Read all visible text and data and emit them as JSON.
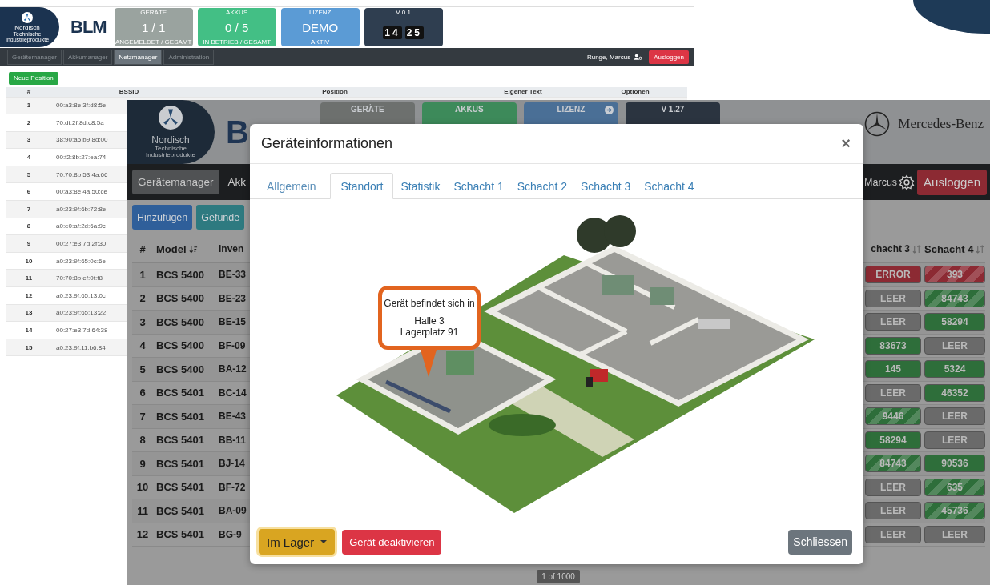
{
  "back_window": {
    "brand": {
      "name": "Nordisch",
      "tagline": "Technische Industrieprodukte",
      "logo": "BLM"
    },
    "tiles": [
      {
        "kind": "stat",
        "title": "GERÄTE",
        "value": "1 / 1",
        "caption": "ANGEMELDET / GESAMT",
        "color": "#9aa39f"
      },
      {
        "kind": "stat",
        "title": "AKKUS",
        "value": "0 / 5",
        "caption": "IN BETRIEB / GESAMT",
        "color": "#43bf85"
      },
      {
        "kind": "stat",
        "title": "LIZENZ",
        "value": "DEMO",
        "caption": "AKTIV",
        "color": "#5b9bd5"
      },
      {
        "kind": "clock",
        "title": "V 0.1",
        "digits": [
          "14",
          "25"
        ],
        "color": "#2f3e50"
      }
    ],
    "nav": [
      {
        "label": "Gerätemanager",
        "selected": false
      },
      {
        "label": "Akkumanager",
        "selected": false
      },
      {
        "label": "Netzmanager",
        "selected": true
      },
      {
        "label": "Administration",
        "selected": false
      }
    ],
    "user": "Runge, Marcus",
    "logout": "Ausloggen",
    "new_button": "Neue Position",
    "table": {
      "columns": [
        "#",
        "BSSID",
        "Position",
        "Eigener Text",
        "Optionen"
      ],
      "rows": [
        {
          "index": "1",
          "bssid": "00:a3:8e:3f:d8:5e"
        },
        {
          "index": "2",
          "bssid": "70:df:2f:8d:c8:5a"
        },
        {
          "index": "3",
          "bssid": "38:90:a5:b9:8d:00"
        },
        {
          "index": "4",
          "bssid": "00:f2:8b:27:ea:74"
        },
        {
          "index": "5",
          "bssid": "70:70:8b:53:4a:66"
        },
        {
          "index": "6",
          "bssid": "00:a3:8e:4a:50:ce"
        },
        {
          "index": "7",
          "bssid": "a0:23:9f:6b:72:8e"
        },
        {
          "index": "8",
          "bssid": "a0:e0:af:2d:6a:9c"
        },
        {
          "index": "9",
          "bssid": "00:27:e3:7d:2f:30"
        },
        {
          "index": "10",
          "bssid": "a0:23:9f:65:0c:6e"
        },
        {
          "index": "11",
          "bssid": "70:70:8b:ef:0f:f8"
        },
        {
          "index": "12",
          "bssid": "a0:23:9f:65:13:0c"
        },
        {
          "index": "13",
          "bssid": "a0:23:9f:65:13:22"
        },
        {
          "index": "14",
          "bssid": "00:27:e3:7d:64:38"
        },
        {
          "index": "15",
          "bssid": "a0:23:9f:11:b6:84"
        }
      ]
    }
  },
  "front_window": {
    "brand": {
      "name": "Nordisch",
      "tagline": "Technische Industrieprodukte",
      "logo": "B"
    },
    "tiles": [
      {
        "title": "GERÄTE",
        "color": "#6d706e",
        "link": false
      },
      {
        "title": "AKKUS",
        "color": "#3d8a5a",
        "link": false
      },
      {
        "title": "LIZENZ",
        "color": "#4a6f96",
        "link": true
      },
      {
        "title": "V 1.27",
        "color": "#2b3440",
        "link": false
      }
    ],
    "partner": "Mercedes-Benz",
    "nav": [
      {
        "label": "Gerätemanager",
        "selected": true
      },
      {
        "label": "Akk",
        "selected": false
      }
    ],
    "user": "Marcus",
    "logout": "Ausloggen",
    "buttons": [
      {
        "label": "Hinzufügen",
        "kind": "primary"
      },
      {
        "label": "Gefunde",
        "kind": "info"
      }
    ],
    "table": {
      "columns": [
        {
          "label": "#"
        },
        {
          "label": "Model",
          "sorted": true
        },
        {
          "label": "Inven"
        },
        {
          "label": "chacht 3",
          "sorted": false
        },
        {
          "label": "Schacht 4",
          "sorted": false
        }
      ],
      "rows": [
        {
          "index": "1",
          "model": "BCS 5400",
          "inventory": "BE-33",
          "slots": [
            {
              "label": "ERROR",
              "kind": "error",
              "striped": false
            },
            {
              "label": "393",
              "kind": "error",
              "striped": true
            }
          ]
        },
        {
          "index": "2",
          "model": "BCS 5400",
          "inventory": "BE-23",
          "slots": [
            {
              "label": "LEER",
              "kind": "empty",
              "striped": false
            },
            {
              "label": "84743",
              "kind": "ok",
              "striped": true
            }
          ]
        },
        {
          "index": "3",
          "model": "BCS 5400",
          "inventory": "BE-15",
          "slots": [
            {
              "label": "LEER",
              "kind": "empty",
              "striped": false
            },
            {
              "label": "58294",
              "kind": "ok",
              "striped": false
            }
          ]
        },
        {
          "index": "4",
          "model": "BCS 5400",
          "inventory": "BF-09",
          "slots": [
            {
              "label": "83673",
              "kind": "ok",
              "striped": false
            },
            {
              "label": "LEER",
              "kind": "empty",
              "striped": false
            }
          ]
        },
        {
          "index": "5",
          "model": "BCS 5400",
          "inventory": "BA-12",
          "slots": [
            {
              "label": "145",
              "kind": "ok",
              "striped": false
            },
            {
              "label": "5324",
              "kind": "ok",
              "striped": false
            }
          ]
        },
        {
          "index": "6",
          "model": "BCS 5401",
          "inventory": "BC-14",
          "slots": [
            {
              "label": "LEER",
              "kind": "empty",
              "striped": false
            },
            {
              "label": "46352",
              "kind": "ok",
              "striped": false
            }
          ]
        },
        {
          "index": "7",
          "model": "BCS 5401",
          "inventory": "BE-43",
          "slots": [
            {
              "label": "9446",
              "kind": "ok",
              "striped": true
            },
            {
              "label": "LEER",
              "kind": "empty",
              "striped": false
            }
          ]
        },
        {
          "index": "8",
          "model": "BCS 5401",
          "inventory": "BB-11",
          "slots": [
            {
              "label": "58294",
              "kind": "ok",
              "striped": false
            },
            {
              "label": "LEER",
              "kind": "empty",
              "striped": false
            }
          ]
        },
        {
          "index": "9",
          "model": "BCS 5401",
          "inventory": "BJ-14",
          "slots": [
            {
              "label": "84743",
              "kind": "ok",
              "striped": true
            },
            {
              "label": "90536",
              "kind": "ok",
              "striped": false
            }
          ]
        },
        {
          "index": "10",
          "model": "BCS 5401",
          "inventory": "BF-72",
          "slots": [
            {
              "label": "LEER",
              "kind": "empty",
              "striped": false
            },
            {
              "label": "635",
              "kind": "ok",
              "striped": true
            }
          ]
        },
        {
          "index": "11",
          "model": "BCS 5401",
          "inventory": "BA-09",
          "slots": [
            {
              "label": "LEER",
              "kind": "empty",
              "striped": false
            },
            {
              "label": "45736",
              "kind": "ok",
              "striped": true
            }
          ]
        },
        {
          "index": "12",
          "model": "BCS 5401",
          "inventory": "BG-9",
          "slots": [
            {
              "label": "LEER",
              "kind": "empty",
              "striped": false
            },
            {
              "label": "LEER",
              "kind": "empty",
              "striped": false
            }
          ]
        }
      ]
    },
    "pagination": "1 of 1000"
  },
  "modal": {
    "title": "Geräteinformationen",
    "close": "×",
    "tabs": [
      {
        "label": "Allgemein",
        "selected": false
      },
      {
        "label": "Standort",
        "selected": true
      },
      {
        "label": "Statistik",
        "selected": false
      },
      {
        "label": "Schacht 1",
        "selected": false
      },
      {
        "label": "Schacht 2",
        "selected": false
      },
      {
        "label": "Schacht 3",
        "selected": false
      },
      {
        "label": "Schacht 4",
        "selected": false
      }
    ],
    "callout": [
      "Gerät befindet sich in",
      "Halle 3",
      "Lagerplatz 91"
    ],
    "status_dropdown": "Im Lager",
    "deactivate": "Gerät deaktivieren",
    "close_button": "Schliessen"
  }
}
